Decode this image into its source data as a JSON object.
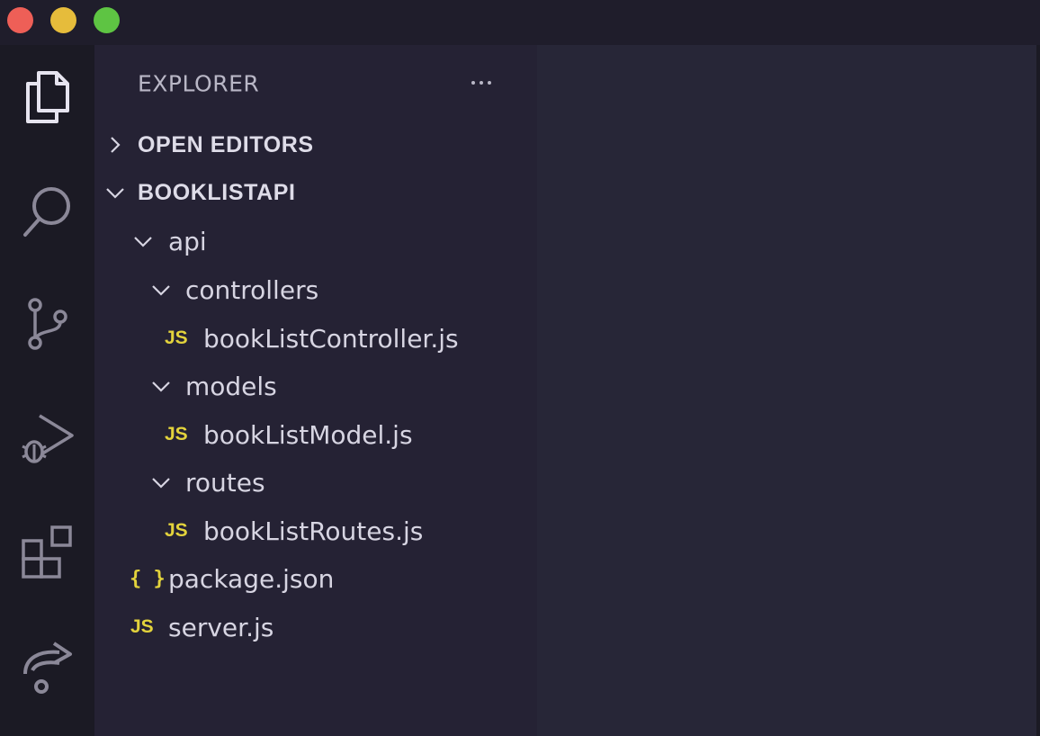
{
  "window": {
    "controls": [
      "close",
      "minimize",
      "maximize"
    ]
  },
  "activity_bar": {
    "items": [
      {
        "icon": "files-icon",
        "active": true
      },
      {
        "icon": "search-icon",
        "active": false
      },
      {
        "icon": "source-control-icon",
        "active": false
      },
      {
        "icon": "run-debug-icon",
        "active": false
      },
      {
        "icon": "extensions-icon",
        "active": false
      },
      {
        "icon": "remote-share-icon",
        "active": false
      }
    ]
  },
  "sidebar": {
    "title": "EXPLORER",
    "sections": {
      "open_editors": {
        "label": "OPEN EDITORS",
        "expanded": false
      },
      "project": {
        "label": "BOOKLISTAPI",
        "expanded": true
      }
    },
    "tree": {
      "api": {
        "label": "api"
      },
      "controllers": {
        "label": "controllers"
      },
      "controller_file": {
        "label": "bookListController.js",
        "badge": "JS"
      },
      "models": {
        "label": "models"
      },
      "model_file": {
        "label": "bookListModel.js",
        "badge": "JS"
      },
      "routes": {
        "label": "routes"
      },
      "routes_file": {
        "label": "bookListRoutes.js",
        "badge": "JS"
      },
      "package_file": {
        "label": "package.json",
        "badge": "{ }"
      },
      "server_file": {
        "label": "server.js",
        "badge": "JS"
      }
    }
  },
  "colors": {
    "background": "#1f1d2b",
    "sidebar": "#252234",
    "editor": "#272637",
    "js_badge": "#e3d33c"
  }
}
